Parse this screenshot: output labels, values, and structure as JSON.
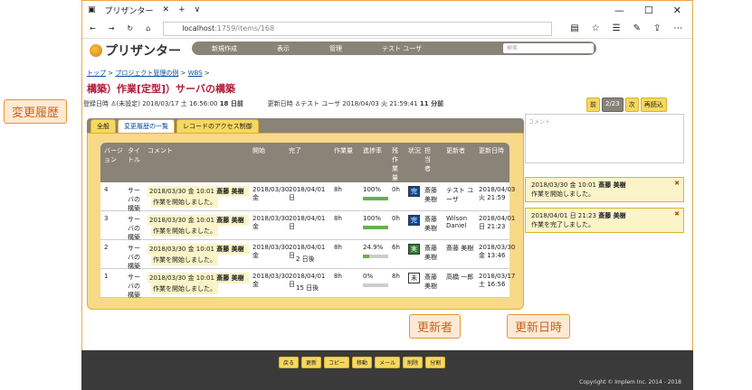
{
  "window": {
    "tab_title": "プリザンター",
    "url_host": "localhost",
    "url_path": ":1759/items/168"
  },
  "app": {
    "logo_text": "プリザンター"
  },
  "menu": {
    "items": [
      "新規作成",
      "表示",
      "管理",
      "テスト ユーザ"
    ],
    "search_placeholder": "検索"
  },
  "breadcrumb": [
    "トップ",
    "プロジェクト管理の例",
    "WBS"
  ],
  "page_title": "構築）作業[定型]）サーバの構築",
  "meta": {
    "created_label": "登録日時",
    "created_user": "(未設定)",
    "created_at": "2018/03/17 土 16:56:00",
    "created_ago": "18 日前",
    "updated_label": "更新日時",
    "updated_user": "テスト ユーザ",
    "updated_at": "2018/04/03 火 21:59:41",
    "updated_ago": "11 分前"
  },
  "pager": {
    "prev": "前",
    "current": "2/23",
    "next": "次",
    "reload": "再読込"
  },
  "tabs": [
    "全般",
    "変更履歴の一覧",
    "レコードのアクセス制御"
  ],
  "table": {
    "headers": [
      "バージョン",
      "タイトル",
      "コメント",
      "開始",
      "完了",
      "作業量",
      "進捗率",
      "残作業量",
      "状況",
      "担当者",
      "更新者",
      "更新日時"
    ],
    "rows": [
      {
        "ver": "4",
        "title": "サーバの構築",
        "comment_date": "2018/03/30 金 10:01",
        "comment_user": "斎藤 美樹",
        "comment_text": "作業を開始しました。",
        "start": "2018/03/30 金",
        "end": "2018/04/01 日",
        "end_note": "",
        "work": "8h",
        "progress": "100%",
        "progress_value": 1.0,
        "remain": "0h",
        "status": "完",
        "assignee": "斎藤 美樹",
        "updater": "テスト ユーザ",
        "updated": "2018/04/03 火 21:59"
      },
      {
        "ver": "3",
        "title": "サーバの構築",
        "comment_date": "2018/03/30 金 10:01",
        "comment_user": "斎藤 美樹",
        "comment_text": "作業を開始しました。",
        "start": "2018/03/30 金",
        "end": "2018/04/01 日",
        "end_note": "",
        "work": "8h",
        "progress": "100%",
        "progress_value": 1.0,
        "remain": "0h",
        "status": "完",
        "assignee": "斎藤 美樹",
        "updater": "Wilson Daniel",
        "updated": "2018/04/01 日 21:23"
      },
      {
        "ver": "2",
        "title": "サーバの構築",
        "comment_date": "2018/03/30 金 10:01",
        "comment_user": "斎藤 美樹",
        "comment_text": "作業を開始しました。",
        "start": "2018/03/30 金",
        "end": "2018/04/01 日",
        "end_note": "2 日後",
        "work": "8h",
        "progress": "24.9%",
        "progress_value": 0.249,
        "remain": "6h",
        "status": "実",
        "assignee": "斎藤 美樹",
        "updater": "斎藤 美樹",
        "updated": "2018/03/30 金 13:46"
      },
      {
        "ver": "1",
        "title": "サーバの構築",
        "comment_date": "2018/03/30 金 10:01",
        "comment_user": "斎藤 美樹",
        "comment_text": "作業を開始しました。",
        "start": "2018/03/30 金",
        "end": "2018/04/01 日",
        "end_note": "15 日後",
        "work": "8h",
        "progress": "0%",
        "progress_value": 0,
        "remain": "8h",
        "status": "未",
        "assignee": "斎藤 美樹",
        "updater": "高橋 一郎",
        "updated": "2018/03/17 土 16:56"
      }
    ]
  },
  "side": {
    "comment_placeholder": "コメント",
    "history": [
      {
        "date": "2018/03/30 金 10:01",
        "user": "斎藤 美樹",
        "text": "作業を開始しました。"
      },
      {
        "date": "2018/04/01 日 21:23",
        "user": "斎藤 美樹",
        "text": "作業を完了しました。"
      }
    ]
  },
  "footer_buttons": [
    "戻る",
    "更新",
    "コピー",
    "移動",
    "メール",
    "削除",
    "分割"
  ],
  "copyright": "Copyright © Implem Inc. 2014 - 2018",
  "callouts": {
    "history": "変更履歴",
    "updater": "更新者",
    "updated_at": "更新日時"
  }
}
